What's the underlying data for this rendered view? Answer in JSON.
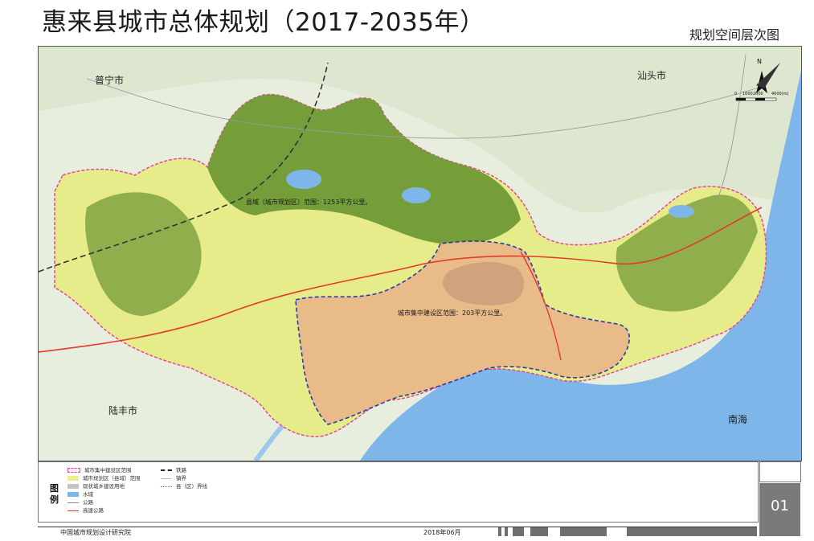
{
  "title": "惠来县城市总体规划（2017-2035年）",
  "subtitle": "规划空间层次图",
  "map": {
    "labels": {
      "puning": "普宁市",
      "shantou": "汕头市",
      "lufeng": "陆丰市",
      "nanhai": "南海",
      "county_area": "县域（城市规划区）范围：1253平方公里。",
      "central_area": "城市集中建设区范围：203平方公里。"
    },
    "scale_bar": {
      "ticks": [
        "0",
        "1000",
        "2000",
        "4000(m)"
      ]
    },
    "north_label": "N"
  },
  "legend": {
    "heading": "图例",
    "items": [
      {
        "label": "城市集中建设区范围",
        "kind": "dash-box-pink"
      },
      {
        "label": "城市规划区（县域）范围",
        "kind": "fill-yellow"
      },
      {
        "label": "现状城乡建设用地",
        "kind": "fill-grey"
      },
      {
        "label": "水域",
        "kind": "fill-blue"
      },
      {
        "label": "公路",
        "kind": "line-grey"
      },
      {
        "label": "高速公路",
        "kind": "line-red"
      },
      {
        "label": "铁路",
        "kind": "line-dash-black"
      },
      {
        "label": "镇界",
        "kind": "line-thin"
      },
      {
        "label": "县（区）界线",
        "kind": "line-dot-pink"
      }
    ]
  },
  "page_number": "01",
  "footer": {
    "organization": "中国城市规划设计研究院",
    "date": "2018年06月"
  },
  "colors": {
    "county_fill": "#e6ec8a",
    "mountain_dark": "#5c8c2c",
    "central_fill": "#e9b98a",
    "sea": "#7fb6ea",
    "county_boundary": "#e8479a",
    "central_boundary": "#2233aa",
    "highway": "#e23b2b"
  }
}
